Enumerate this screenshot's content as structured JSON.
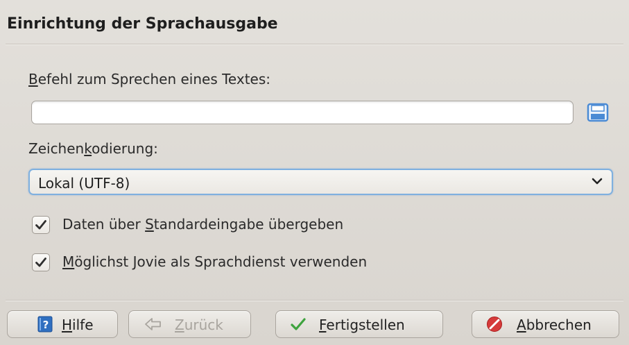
{
  "dialog": {
    "title": "Einrichtung der Sprachausgabe"
  },
  "command": {
    "label_mnemonic": "B",
    "label_rest": "efehl zum Sprechen eines Textes:",
    "value": "",
    "save_icon": "save-icon"
  },
  "encoding": {
    "label_pre": "Zeichen",
    "label_mnemonic": "k",
    "label_post": "odierung:",
    "selected": "Lokal (UTF-8)",
    "arrow_icon": "chevron-down-icon"
  },
  "options": [
    {
      "checked": true,
      "label_pre": "Daten über ",
      "label_mnemonic": "S",
      "label_post": "tandardeingabe übergeben"
    },
    {
      "checked": true,
      "label_pre": "",
      "label_mnemonic": "M",
      "label_post": "öglichst Jovie als Sprachdienst verwenden"
    }
  ],
  "buttons": {
    "help": {
      "mnemonic": "H",
      "rest": "ilfe",
      "icon": "help-icon"
    },
    "back": {
      "mnemonic": "Z",
      "rest": "urück",
      "icon": "back-arrow-icon",
      "enabled": false
    },
    "finish": {
      "mnemonic": "F",
      "rest": "ertigstellen",
      "icon": "checkmark-icon"
    },
    "cancel": {
      "mnemonic": "A",
      "rest": "bbrechen",
      "icon": "cancel-icon"
    }
  },
  "colors": {
    "focus": "#7fb0df",
    "save_icon": "#4a8ad4",
    "check": "#2f2f2f",
    "finish_icon": "#3ea33e",
    "cancel_icon": "#d63a3a",
    "help_icon": "#2f6fc0"
  }
}
